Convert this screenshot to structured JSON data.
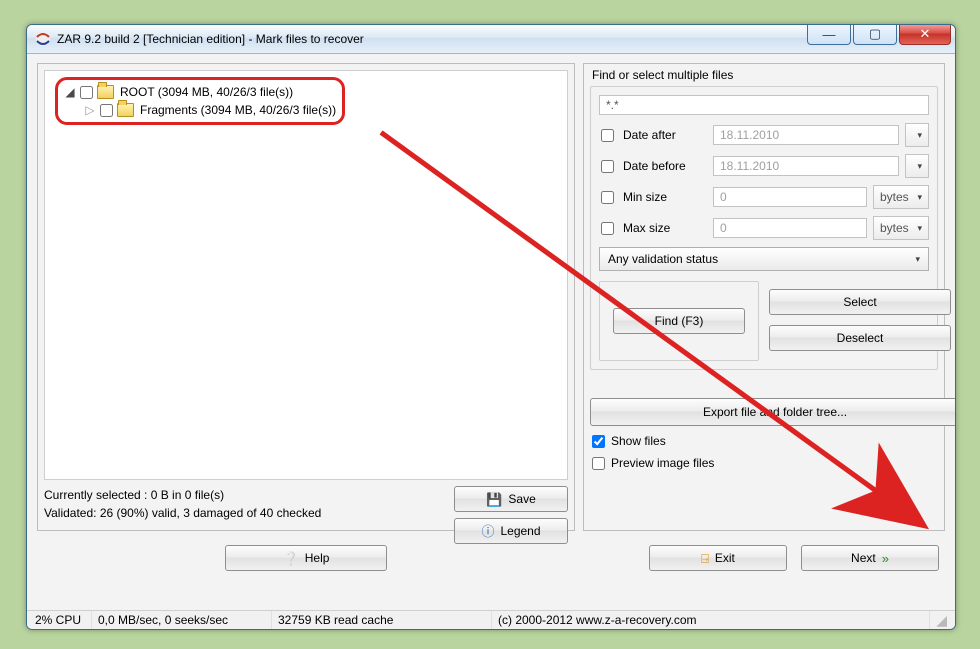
{
  "window": {
    "title": "ZAR 9.2 build 2 [Technician edition] - Mark files to recover"
  },
  "winctrl": {
    "min_sym": "—",
    "max_sym": "▢",
    "close_sym": "✕"
  },
  "tree": {
    "root": {
      "name": "ROOT (3094 MB, 40/26/3 file(s))"
    },
    "child1": {
      "name": "Fragments (3094 MB, 40/26/3 file(s))"
    }
  },
  "leftstats": {
    "selected": "Currently selected : 0 B in 0 file(s)",
    "validated": "Validated: 26 (90%)  valid, 3 damaged of 40 checked"
  },
  "leftbtns": {
    "save": "Save",
    "legend": "Legend"
  },
  "filters": {
    "heading": "Find or select multiple files",
    "mask": "*.*",
    "date_after_lbl": "Date after",
    "date_after_val": "18.11.2010",
    "date_before_lbl": "Date before",
    "date_before_val": "18.11.2010",
    "min_size_lbl": "Min size",
    "min_size_val": "0",
    "max_size_lbl": "Max size",
    "max_size_val": "0",
    "unit": "bytes",
    "validation": "Any validation status",
    "find_btn": "Find (F3)",
    "select_btn": "Select",
    "deselect_btn": "Deselect",
    "export_btn": "Export file and folder tree...",
    "show_files": "Show files",
    "preview": "Preview image files"
  },
  "footer": {
    "help": "Help",
    "exit": "Exit",
    "next": "Next"
  },
  "status": {
    "cpu": "2% CPU",
    "io": "0,0 MB/sec, 0 seeks/sec",
    "cache": "32759 KB read cache",
    "copyright": "(c) 2000-2012 www.z-a-recovery.com"
  }
}
